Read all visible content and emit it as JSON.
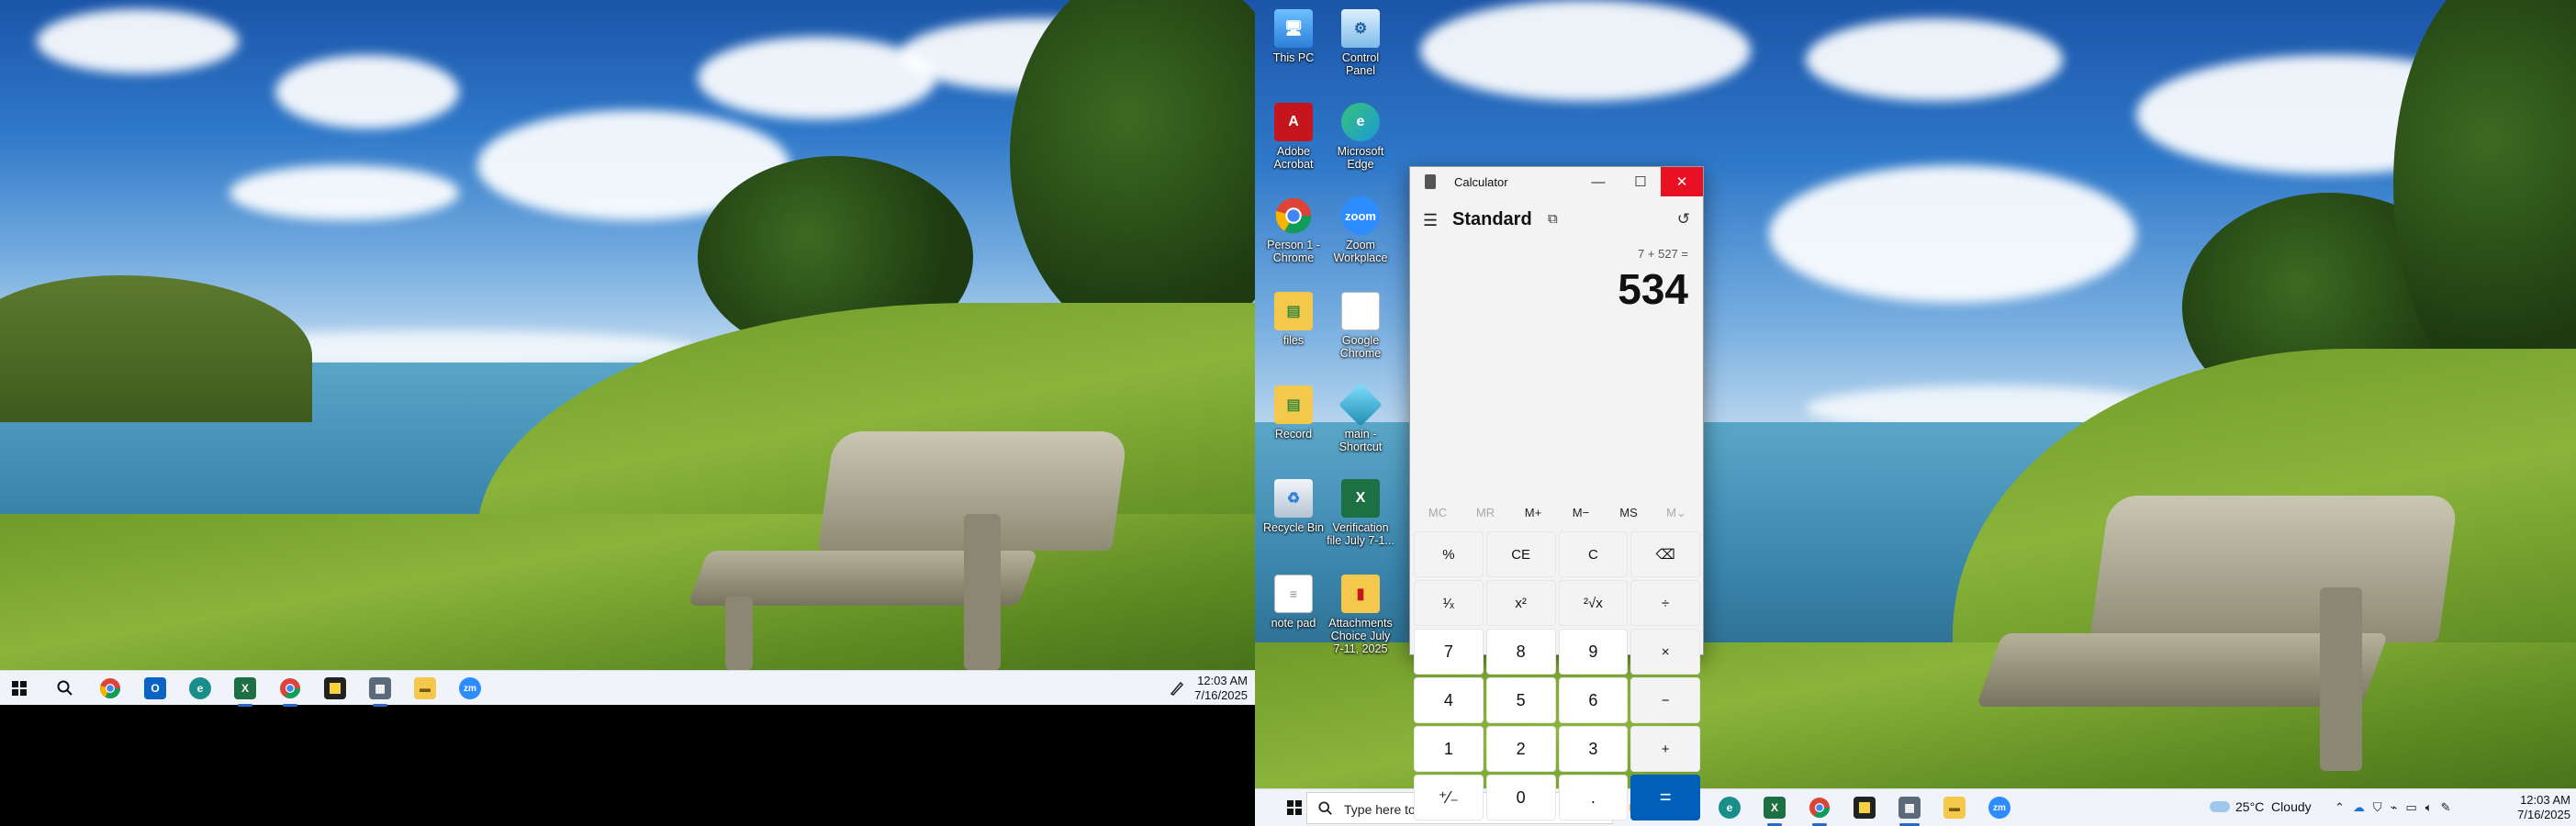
{
  "left_screen": {
    "taskbar": {
      "apps": [
        "start-icon",
        "search-icon",
        "chrome-icon",
        "outlook-icon",
        "edge-dev-icon",
        "excel-icon",
        "chrome-profile-icon",
        "sticky-notes-icon",
        "calculator-icon",
        "file-explorer-icon",
        "zoom-icon"
      ],
      "clock_time": "12:03 AM",
      "clock_date": "7/16/2025"
    }
  },
  "desktop_icons": [
    {
      "label": "This PC",
      "icon": "this-pc-icon",
      "color": "#3a8ee6"
    },
    {
      "label": "Control Panel",
      "icon": "control-panel-icon",
      "color": "#4aa3e8"
    },
    {
      "label": "Adobe Acrobat",
      "icon": "acrobat-icon",
      "color": "#c4161c"
    },
    {
      "label": "Microsoft Edge",
      "icon": "edge-icon",
      "color": "#1c9ad6"
    },
    {
      "label": "Person 1 - Chrome",
      "icon": "chrome-icon",
      "color": "#db4437"
    },
    {
      "label": "Zoom Workplace",
      "icon": "zoom-icon",
      "color": "#2d8cff"
    },
    {
      "label": "files",
      "icon": "folder-icon",
      "color": "#f4c84a"
    },
    {
      "label": "Google Chrome",
      "icon": "document-icon",
      "color": "#ffffff"
    },
    {
      "label": "Record",
      "icon": "folder-icon",
      "color": "#f4c84a"
    },
    {
      "label": "main - Shortcut",
      "icon": "app-shortcut-icon",
      "color": "#2fa9c9"
    },
    {
      "label": "Recycle Bin",
      "icon": "recycle-bin-icon",
      "color": "#cfd8e2"
    },
    {
      "label": "Verification file July 7-1...",
      "icon": "excel-file-icon",
      "color": "#1d7044"
    },
    {
      "label": "note pad",
      "icon": "text-file-icon",
      "color": "#ffffff"
    },
    {
      "label": "Attachments Choice July 7-11, 2025",
      "icon": "pdf-folder-icon",
      "color": "#c4161c"
    }
  ],
  "calculator": {
    "title": "Calculator",
    "mode": "Standard",
    "expression": "7 + 527 =",
    "result": "534",
    "memory_buttons": [
      "MC",
      "MR",
      "M+",
      "M−",
      "MS",
      "M⌄"
    ],
    "memory_disabled": [
      true,
      true,
      false,
      false,
      false,
      true
    ],
    "keys": [
      "%",
      "CE",
      "C",
      "⌫",
      "¹⁄ₓ",
      "x²",
      "²√x",
      "÷",
      "7",
      "8",
      "9",
      "×",
      "4",
      "5",
      "6",
      "−",
      "1",
      "2",
      "3",
      "+",
      "⁺⁄₋",
      "0",
      ".",
      "="
    ],
    "accent_color": "#005fb8"
  },
  "right_screen": {
    "taskbar": {
      "search_placeholder": "Type here to search",
      "weather": "25°C  Cloudy",
      "clock_time": "12:03 AM",
      "clock_date": "7/16/2025"
    }
  }
}
